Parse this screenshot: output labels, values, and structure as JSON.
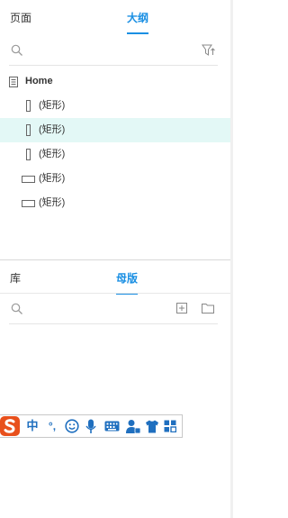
{
  "top_tabs": [
    {
      "label": "页面",
      "active": false
    },
    {
      "label": "大纲",
      "active": true
    }
  ],
  "outline_search": {
    "placeholder": ""
  },
  "outline_tree": {
    "root": "Home",
    "items": [
      {
        "label": "(矩形)",
        "shape": "vertical-rect",
        "selected": false
      },
      {
        "label": "(矩形)",
        "shape": "vertical-rect",
        "selected": true
      },
      {
        "label": "(矩形)",
        "shape": "vertical-rect",
        "selected": false
      },
      {
        "label": "(矩形)",
        "shape": "horizontal-rect",
        "selected": false
      },
      {
        "label": "(矩形)",
        "shape": "horizontal-rect",
        "selected": false
      }
    ]
  },
  "bottom_tabs": [
    {
      "label": "库",
      "active": false
    },
    {
      "label": "母版",
      "active": true
    }
  ],
  "masters_search": {
    "placeholder": ""
  },
  "ime": {
    "chinese": "中",
    "punct": "°,",
    "accent": "#1f6fbf",
    "brand": "#e8501c"
  },
  "colors": {
    "accent": "#1a8fe3",
    "selected_row": "#e3f8f6"
  }
}
